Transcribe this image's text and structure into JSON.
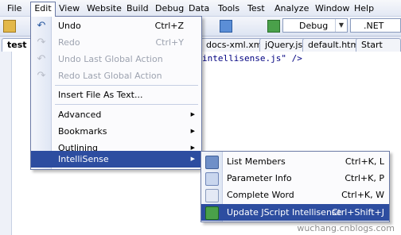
{
  "menubar": {
    "items": [
      "File",
      "Edit",
      "View",
      "Website",
      "Build",
      "Debug",
      "Data",
      "Tools",
      "Test",
      "Analyze",
      "Window",
      "Help"
    ]
  },
  "toolbar": {
    "config_combo": "Debug",
    "platform_combo": ".NET"
  },
  "tabs": [
    {
      "label": "test"
    },
    {
      "label": "docs-xml.xml"
    },
    {
      "label": "jQuery.js"
    },
    {
      "label": "default.htm"
    },
    {
      "label": "Start Page"
    }
  ],
  "editor": {
    "code_line": "intellisense.js\" />"
  },
  "edit_menu": {
    "items": [
      {
        "label": "Undo",
        "shortcut": "Ctrl+Z",
        "icon": "undo-icon",
        "enabled": true
      },
      {
        "label": "Redo",
        "shortcut": "Ctrl+Y",
        "icon": "redo-icon",
        "enabled": false
      },
      {
        "label": "Undo Last Global Action",
        "shortcut": "",
        "icon": "undo-global-icon",
        "enabled": false
      },
      {
        "label": "Redo Last Global Action",
        "shortcut": "",
        "icon": "redo-global-icon",
        "enabled": false
      },
      {
        "label": "Insert File As Text...",
        "shortcut": "",
        "enabled": true
      },
      {
        "label": "Advanced",
        "submenu": true
      },
      {
        "label": "Bookmarks",
        "submenu": true
      },
      {
        "label": "Outlining",
        "submenu": true
      },
      {
        "label": "IntelliSense",
        "submenu": true,
        "highlighted": true
      }
    ]
  },
  "intellisense_menu": {
    "items": [
      {
        "label": "List Members",
        "shortcut": "Ctrl+K, L",
        "icon": "list-members-icon"
      },
      {
        "label": "Parameter Info",
        "shortcut": "Ctrl+K, P",
        "icon": "parameter-info-icon"
      },
      {
        "label": "Complete Word",
        "shortcut": "Ctrl+K, W",
        "icon": "complete-word-icon"
      },
      {
        "label": "Update JScript Intellisense",
        "shortcut": "Ctrl+Shift+J",
        "icon": "update-icon",
        "highlighted": true
      }
    ]
  },
  "watermark": "wuchang.cnblogs.com",
  "colors": {
    "highlight": "#2d4da0",
    "menu_border": "#6b7aa5",
    "disabled_text": "#9da3b0"
  }
}
